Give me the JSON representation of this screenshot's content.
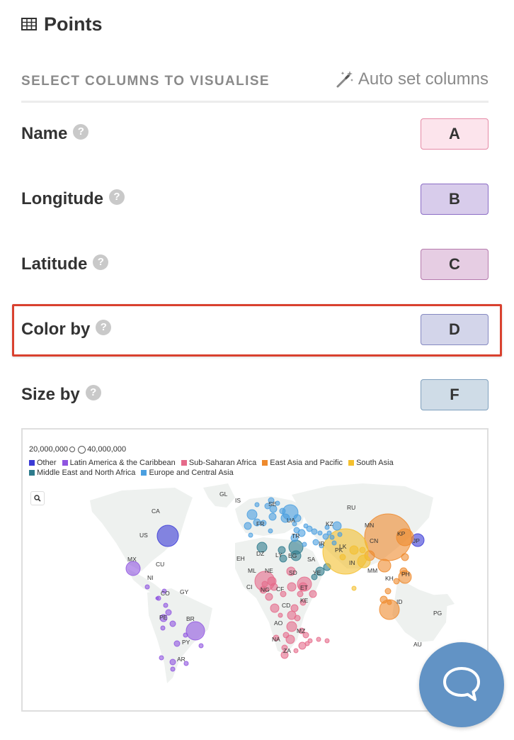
{
  "header": {
    "title": "Points",
    "icon": "table-icon"
  },
  "section": {
    "label": "SELECT COLUMNS TO VISUALISE",
    "auto_set": "Auto set columns",
    "auto_set_icon": "magic-wand-icon"
  },
  "rows": [
    {
      "label": "Name",
      "column": "A",
      "bg": "#fce4ec",
      "border": "#e58aa6"
    },
    {
      "label": "Longitude",
      "column": "B",
      "bg": "#d8cceb",
      "border": "#8b6cc5"
    },
    {
      "label": "Latitude",
      "column": "C",
      "bg": "#e6cde3",
      "border": "#b57aad"
    },
    {
      "label": "Color by",
      "column": "D",
      "bg": "#d3d5ea",
      "border": "#8589c1"
    },
    {
      "label": "Size by",
      "column": "F",
      "bg": "#cfdce7",
      "border": "#7fa0bd"
    }
  ],
  "help_glyph": "?",
  "preview": {
    "size_legend": {
      "small": "20,000,000",
      "large": "40,000,000"
    },
    "legend": [
      {
        "name": "Other",
        "color": "#3b3bd6"
      },
      {
        "name": "Latin America & the Caribbean",
        "color": "#8f55e0"
      },
      {
        "name": "Sub-Saharan Africa",
        "color": "#e56a8a"
      },
      {
        "name": "East Asia and Pacific",
        "color": "#ee8a2d"
      },
      {
        "name": "South Asia",
        "color": "#f4c02e"
      },
      {
        "name": "Middle East and North Africa",
        "color": "#2e7b8c"
      },
      {
        "name": "Europe and Central Asia",
        "color": "#4a9fe0"
      }
    ],
    "country_labels": [
      "GL",
      "IS",
      "SE",
      "RU",
      "CA",
      "FR",
      "UA",
      "KZ",
      "MN",
      "US",
      "TR",
      "CN",
      "KP",
      "JP",
      "IR",
      "DZ",
      "LY",
      "EG",
      "LK",
      "PK",
      "EH",
      "SA",
      "IN",
      "MX",
      "MM",
      "CU",
      "ML",
      "NE",
      "SD",
      "YE",
      "PH",
      "NI",
      "GY",
      "CI",
      "NG",
      "CF",
      "ET",
      "KH",
      "CO",
      "KE",
      "ID",
      "CD",
      "PG",
      "PE",
      "BR",
      "AO",
      "MZ",
      "PY",
      "NA",
      "AU",
      "ZA",
      "AR"
    ]
  },
  "chat": {
    "icon": "chat-bubble-icon"
  }
}
